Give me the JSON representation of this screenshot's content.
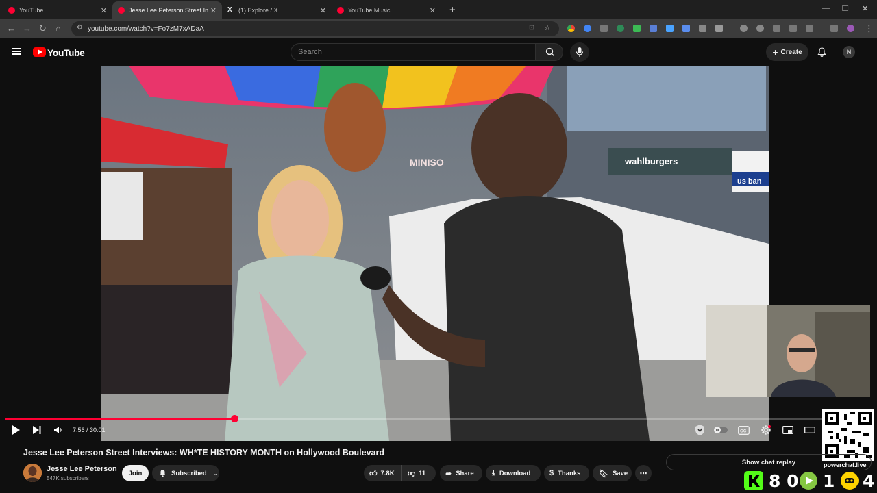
{
  "browser": {
    "tabs": [
      {
        "title": "YouTube",
        "favicon_color": "#ff0033",
        "active": false
      },
      {
        "title": "Jesse Lee Peterson Street Interv",
        "favicon_color": "#ff0033",
        "active": true
      },
      {
        "title": "(1) Explore / X",
        "favicon_color": "#e7e9ea",
        "active": false
      },
      {
        "title": "YouTube Music",
        "favicon_color": "#ff0033",
        "active": false
      }
    ],
    "url": "youtube.com/watch?v=Fo7zM7xADaA"
  },
  "header": {
    "logo_text": "YouTube",
    "search_placeholder": "Search",
    "create_label": "Create",
    "avatar_letter": "N"
  },
  "player": {
    "time": "7:56 / 30:01",
    "progress_fraction": 0.264,
    "overlay": {
      "storefront_1": "MINISO",
      "storefront_2": "wahlburgers",
      "storefront_3": "us ban"
    }
  },
  "video": {
    "title": "Jesse Lee Peterson Street Interviews: WH*TE HISTORY MONTH on Hollywood Boulevard",
    "channel": "Jesse Lee Peterson",
    "subscribers": "547K subscribers",
    "join_label": "Join",
    "subscribed_label": "Subscribed",
    "likes": "7.8K",
    "dislikes": "11",
    "share_label": "Share",
    "download_label": "Download",
    "thanks_label": "Thanks",
    "save_label": "Save"
  },
  "chat": {
    "replay_label": "Show chat replay"
  },
  "stream_overlay": {
    "qr_caption": "powerchat.live",
    "counter_1": "8 0",
    "counter_2": "1",
    "counter_3": "4"
  },
  "colors": {
    "yt_red": "#ff0000",
    "progress_red": "#ff0033",
    "background": "#0f0f0f"
  }
}
